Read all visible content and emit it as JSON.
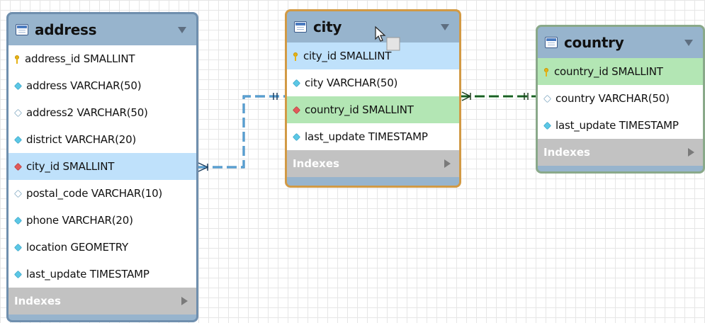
{
  "tables": {
    "address": {
      "title": "address",
      "columns": [
        {
          "label": "address_id SMALLINT",
          "icon": "primary-key-icon"
        },
        {
          "label": "address VARCHAR(50)",
          "icon": "not-null-column-icon"
        },
        {
          "label": "address2 VARCHAR(50)",
          "icon": "nullable-column-icon"
        },
        {
          "label": "district VARCHAR(20)",
          "icon": "not-null-column-icon"
        },
        {
          "label": "city_id SMALLINT",
          "icon": "foreign-key-icon"
        },
        {
          "label": "postal_code VARCHAR(10)",
          "icon": "nullable-column-icon"
        },
        {
          "label": "phone VARCHAR(20)",
          "icon": "not-null-column-icon"
        },
        {
          "label": "location GEOMETRY",
          "icon": "not-null-column-icon"
        },
        {
          "label": "last_update TIMESTAMP",
          "icon": "not-null-column-icon"
        }
      ],
      "indexes_label": "Indexes"
    },
    "city": {
      "title": "city",
      "columns": [
        {
          "label": "city_id SMALLINT",
          "icon": "primary-key-icon"
        },
        {
          "label": "city VARCHAR(50)",
          "icon": "not-null-column-icon"
        },
        {
          "label": "country_id SMALLINT",
          "icon": "foreign-key-icon"
        },
        {
          "label": "last_update TIMESTAMP",
          "icon": "not-null-column-icon"
        }
      ],
      "indexes_label": "Indexes"
    },
    "country": {
      "title": "country",
      "columns": [
        {
          "label": "country_id SMALLINT",
          "icon": "primary-key-icon"
        },
        {
          "label": "country VARCHAR(50)",
          "icon": "nullable-column-icon"
        },
        {
          "label": "last_update TIMESTAMP",
          "icon": "not-null-column-icon"
        }
      ],
      "indexes_label": "Indexes"
    }
  },
  "relationships": [
    {
      "from": "address.city_id",
      "to": "city.city_id",
      "style": "dashed",
      "color": "#1f6fae"
    },
    {
      "from": "city.country_id",
      "to": "country.country_id",
      "style": "dashed",
      "color": "#1f8a2e"
    }
  ],
  "colors": {
    "header": "#97b4cd",
    "selected_border": "#d29a45",
    "highlight_blue": "#bfe1fb",
    "highlight_green": "#b3e6b4",
    "indexes_bar": "#c2c2c2"
  }
}
